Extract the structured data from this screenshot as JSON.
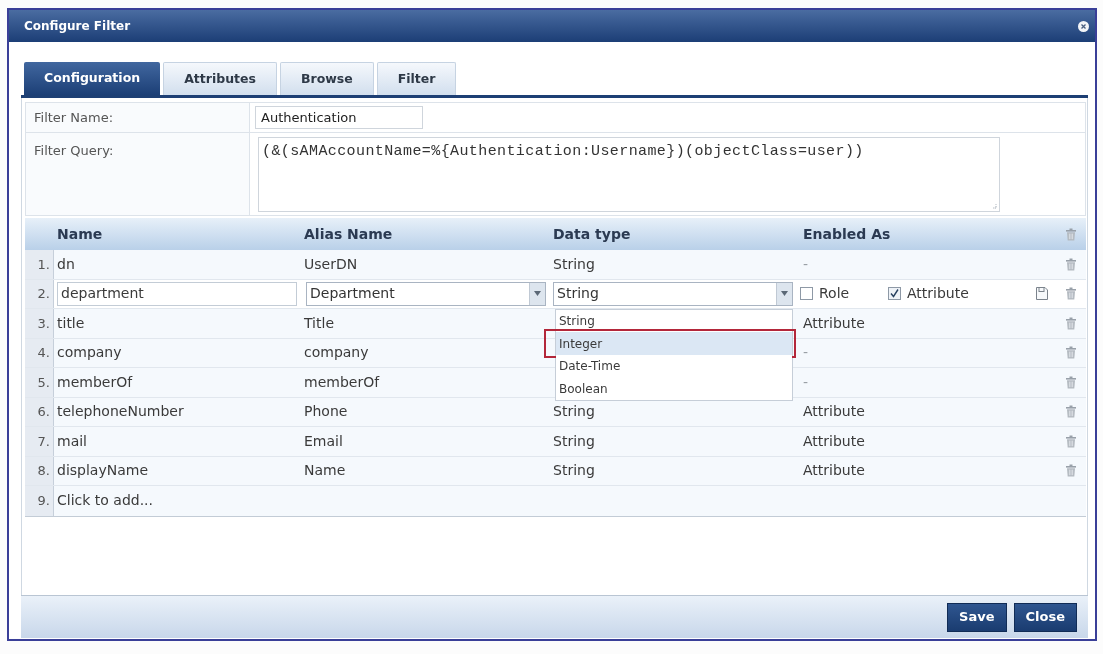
{
  "window": {
    "title": "Configure Filter"
  },
  "tabs": [
    {
      "label": "Configuration",
      "selected": true
    },
    {
      "label": "Attributes",
      "selected": false
    },
    {
      "label": "Browse",
      "selected": false
    },
    {
      "label": "Filter",
      "selected": false
    }
  ],
  "form": {
    "filter_name": {
      "label": "Filter Name:",
      "value": "Authentication"
    },
    "filter_query": {
      "label": "Filter Query:",
      "value": "(&(sAMAccountName=%{Authentication:Username})(objectClass=user))"
    }
  },
  "table": {
    "columns": [
      "Name",
      "Alias Name",
      "Data type",
      "Enabled As"
    ],
    "rows": [
      {
        "kind": "plain",
        "number": "1.",
        "name": "dn",
        "alias": "UserDN",
        "data_type": "String",
        "enabled_as": "-"
      },
      {
        "kind": "edit",
        "number": "2.",
        "name": "department",
        "alias": "Department",
        "data_type": "String",
        "role": {
          "label": "Role",
          "checked": false
        },
        "attribute": {
          "label": "Attribute",
          "checked": true
        },
        "type_menu": {
          "options": [
            {
              "label": "String",
              "highlighted": false
            },
            {
              "label": "Integer",
              "highlighted": true
            },
            {
              "label": "Date-Time",
              "highlighted": false
            },
            {
              "label": "Boolean",
              "highlighted": false
            }
          ]
        }
      },
      {
        "kind": "plain",
        "number": "3.",
        "name": "title",
        "alias": "Title",
        "enabled_as": "Attribute"
      },
      {
        "kind": "plain",
        "number": "4.",
        "name": "company",
        "alias": "company",
        "enabled_as": "-"
      },
      {
        "kind": "plain",
        "number": "5.",
        "name": "memberOf",
        "alias": "memberOf",
        "enabled_as": "-"
      },
      {
        "kind": "plain",
        "number": "6.",
        "name": "telephoneNumber",
        "alias": "Phone",
        "data_type": "String",
        "enabled_as": "Attribute"
      },
      {
        "kind": "plain",
        "number": "7.",
        "name": "mail",
        "alias": "Email",
        "data_type": "String",
        "enabled_as": "Attribute"
      },
      {
        "kind": "plain",
        "number": "8.",
        "name": "displayName",
        "alias": "Name",
        "data_type": "String",
        "enabled_as": "Attribute"
      },
      {
        "kind": "add",
        "number": "9.",
        "label": "Click to add..."
      }
    ]
  },
  "buttons": [
    "Save",
    "Close"
  ]
}
